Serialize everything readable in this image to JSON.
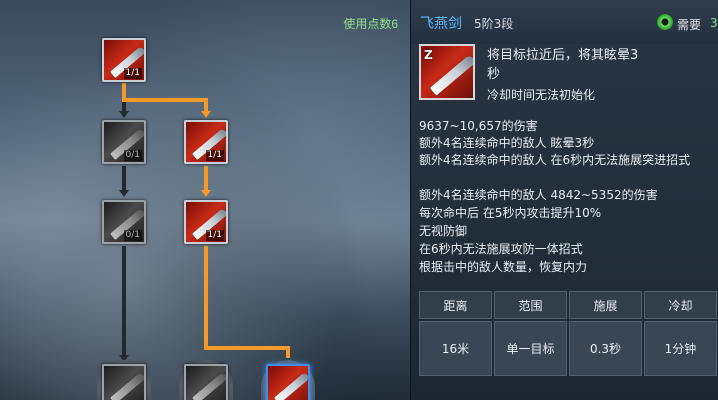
{
  "tree": {
    "points_label": "使用点数6",
    "skills": [
      {
        "id": "top",
        "level": "1/1",
        "state": "active"
      },
      {
        "id": "r2c1",
        "level": "0/1",
        "state": "locked"
      },
      {
        "id": "r2c2",
        "level": "1/1",
        "state": "active"
      },
      {
        "id": "r3c1",
        "level": "0/1",
        "state": "locked"
      },
      {
        "id": "r3c2",
        "level": "1/1",
        "state": "active"
      }
    ]
  },
  "panel": {
    "skill_name": "飞燕剑",
    "skill_rank": "5阶3段",
    "need_label": "需要",
    "need_value": "3",
    "key": "Z",
    "desc_line1": "将目标拉近后，将其眩晕3",
    "desc_line2": "秒",
    "desc_line3": "冷却时间无法初始化",
    "effects": [
      "9637~10,657的伤害",
      "额外4名连续命中的敌人 眩晕3秒",
      "额外4名连续命中的敌人 在6秒内无法施展突进招式",
      "额外4名连续命中的敌人 4842~5352的伤害",
      "每次命中后 在5秒内攻击提升10%",
      "无视防御",
      "在6秒内无法施展攻防一体招式",
      "根据击中的敌人数量，恢复内力"
    ],
    "stats": {
      "headers": [
        "距离",
        "范围",
        "施展",
        "冷却"
      ],
      "values": [
        "16米",
        "单一目标",
        "0.3秒",
        "1分钟"
      ]
    }
  },
  "colors": {
    "active_link": "#f39a2a",
    "inactive_link": "#24292e",
    "skill_name": "#5bb7ff",
    "points": "#8fe08a"
  }
}
